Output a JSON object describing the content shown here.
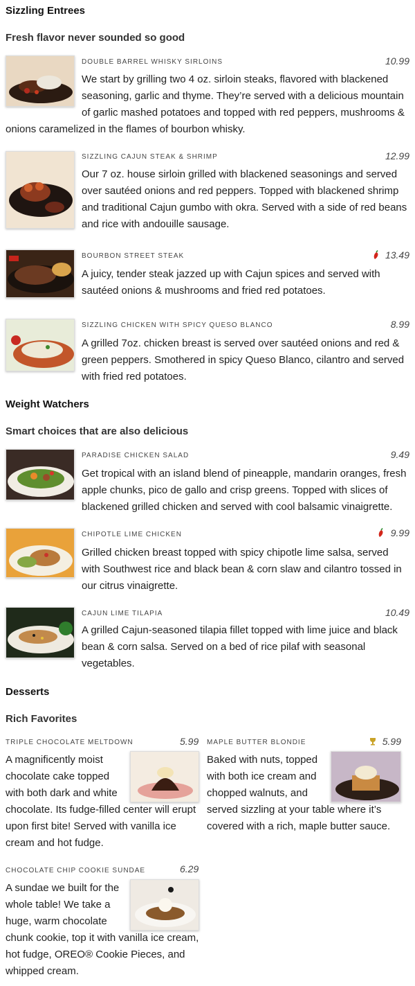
{
  "sections": [
    {
      "title": "Sizzling Entrees",
      "subtitle": "Fresh flavor never sounded so good"
    },
    {
      "title": "Weight Watchers",
      "subtitle": "Smart choices that are also delicious"
    },
    {
      "title": "Desserts",
      "subtitle": "Rich Favorites"
    }
  ],
  "entrees": [
    {
      "name": "Double Barrel Whisky Sirloins",
      "price": "10.99",
      "description": "We start by grilling two 4 oz. sirloin steaks, flavored with blackened seasoning, garlic and thyme. They’re served with a delicious mountain of garlic mashed potatoes and topped with red peppers, mushrooms & onions caramelized in the flames of bourbon whisky.",
      "icon": ""
    },
    {
      "name": "Sizzling Cajun Steak & Shrimp",
      "price": "12.99",
      "description": "Our 7 oz. house sirloin grilled with blackened seasonings and served over sautéed onions and red peppers. Topped with blackened shrimp and traditional Cajun gumbo with okra. Served with a side of red beans and rice with andouille sausage.",
      "icon": ""
    },
    {
      "name": "Bourbon Street Steak",
      "price": "13.49",
      "description": "A juicy, tender steak jazzed up with Cajun spices and served with sautéed onions & mushrooms and fried red potatoes.",
      "icon": "chili-pepper-icon"
    },
    {
      "name": "Sizzling Chicken with Spicy Queso Blanco",
      "price": "8.99",
      "description": "A grilled 7oz. chicken breast is served over sautéed onions and red & green peppers. Smothered in spicy Queso Blanco, cilantro and served with fried red potatoes.",
      "icon": ""
    }
  ],
  "weight_watchers": [
    {
      "name": "Paradise Chicken Salad",
      "price": "9.49",
      "description": "Get tropical with an island blend of pineapple, mandarin oranges, fresh apple chunks, pico de gallo and crisp greens. Topped with slices of blackened grilled chicken and served with cool balsamic vinaigrette.",
      "icon": ""
    },
    {
      "name": "Chipotle Lime Chicken",
      "price": "9.99",
      "description": "Grilled chicken breast topped with spicy chipotle lime salsa, served with Southwest rice and black bean & corn slaw and cilantro tossed in our citrus vinaigrette.",
      "icon": "chili-pepper-icon"
    },
    {
      "name": "Cajun Lime Tilapia",
      "price": "10.49",
      "description": "A grilled Cajun-seasoned tilapia fillet topped with lime juice and black bean & corn salsa. Served on a bed of rice pilaf with seasonal vegetables.",
      "icon": ""
    }
  ],
  "desserts": [
    {
      "name": "Triple Chocolate Meltdown",
      "price": "5.99",
      "description": "A magnificently moist chocolate cake topped with both dark and white chocolate. Its fudge-filled center will erupt upon first bite! Served with vanilla ice cream and hot fudge.",
      "icon": ""
    },
    {
      "name": "Maple Butter Blondie",
      "price": "5.99",
      "description": "Baked with nuts, topped with both ice cream and chopped walnuts, and served sizzling at your table where it’s covered with a rich, maple butter sauce.",
      "icon": "trophy-icon"
    },
    {
      "name": "Chocolate Chip Cookie Sundae",
      "price": "6.29",
      "description": "A sundae we built for the whole table! We take a huge, warm chocolate chunk cookie, top it with vanilla ice cream, hot fudge, OREO® Cookie Pieces, and whipped cream.",
      "icon": ""
    }
  ],
  "colors": {
    "chili_pepper": "#d2261b",
    "trophy": "#c9a227",
    "text": "#222222"
  }
}
